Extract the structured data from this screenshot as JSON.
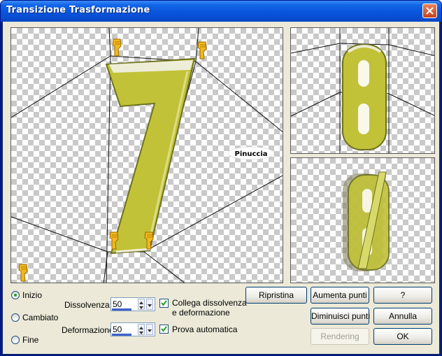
{
  "window": {
    "title": "Transizione Trasformazione",
    "close_icon": "close-icon"
  },
  "watermark": "Pinuccia",
  "previews": {
    "start_digit": "7",
    "end_digit": "8",
    "result_digit": "8"
  },
  "radio": {
    "options": [
      "Inizio",
      "Cambiato",
      "Fine"
    ],
    "selected": "Inizio"
  },
  "dissolvenza": {
    "label": "Dissolvenza:",
    "value": "50"
  },
  "deformazione": {
    "label": "Deformazione:",
    "value": "50"
  },
  "checks": {
    "link_line1": "Collega dissolvenza",
    "link_line2": "e deformazione",
    "link_checked": true,
    "auto": "Prova automatica",
    "auto_checked": true
  },
  "buttons": {
    "ripristina": "Ripristina",
    "aumenta": "Aumenta punti",
    "diminuisci": "Diminuisci punti",
    "rendering": "Rendering",
    "help": "?",
    "annulla": "Annulla",
    "ok": "OK"
  },
  "colors": {
    "title_bar": "#0a55dc",
    "digit_fill": "#c2c238",
    "accent": "#3c62c8"
  }
}
